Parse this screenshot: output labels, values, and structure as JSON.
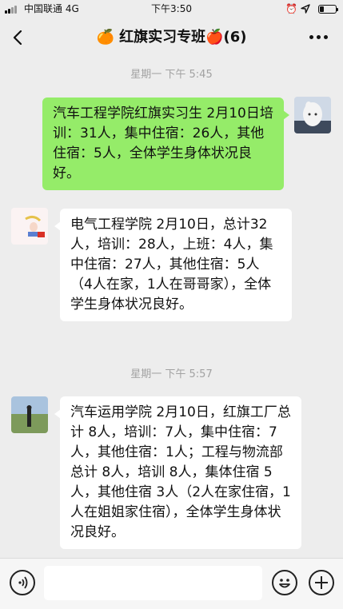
{
  "status_bar": {
    "carrier": "中国联通 4G",
    "time": "下午3:50"
  },
  "nav": {
    "title": "🍊 红旗实习专班🍎(6)",
    "back_icon": "chevron-left-icon",
    "more_icon": "ellipsis-icon"
  },
  "messages": [
    {
      "kind": "timestamp",
      "text": "星期一 下午 5:45"
    },
    {
      "kind": "out",
      "text": "汽车工程学院红旗实习生 2月10日培训：31人，集中住宿：26人，其他住宿：5人，全体学生身体状况良好。"
    },
    {
      "kind": "in",
      "text": "电气工程学院 2月10日，总计32人，培训：28人，上班：4人，集中住宿：27人，其他住宿：5人（4人在家，1人在哥哥家），全体学生身体状况良好。"
    },
    {
      "kind": "timestamp",
      "text": "星期一 下午 5:57"
    },
    {
      "kind": "in",
      "text": "汽车运用学院 2月10日，红旗工厂总计 8人，培训：7人，集中住宿：7人，其他住宿：1人；工程与物流部总计 8人，培训 8人，集体住宿 5人，其他住宿 3人（2人在家住宿，1人在姐姐家住宿），全体学生身体状况良好。"
    }
  ],
  "input_bar": {
    "voice_icon": "voice-icon",
    "emoji_icon": "emoji-icon",
    "plus_icon": "plus-icon"
  },
  "colors": {
    "background": "#ededed",
    "outgoing_bubble": "#95ec69",
    "incoming_bubble": "#ffffff",
    "timestamp_text": "#a2a2a2"
  }
}
